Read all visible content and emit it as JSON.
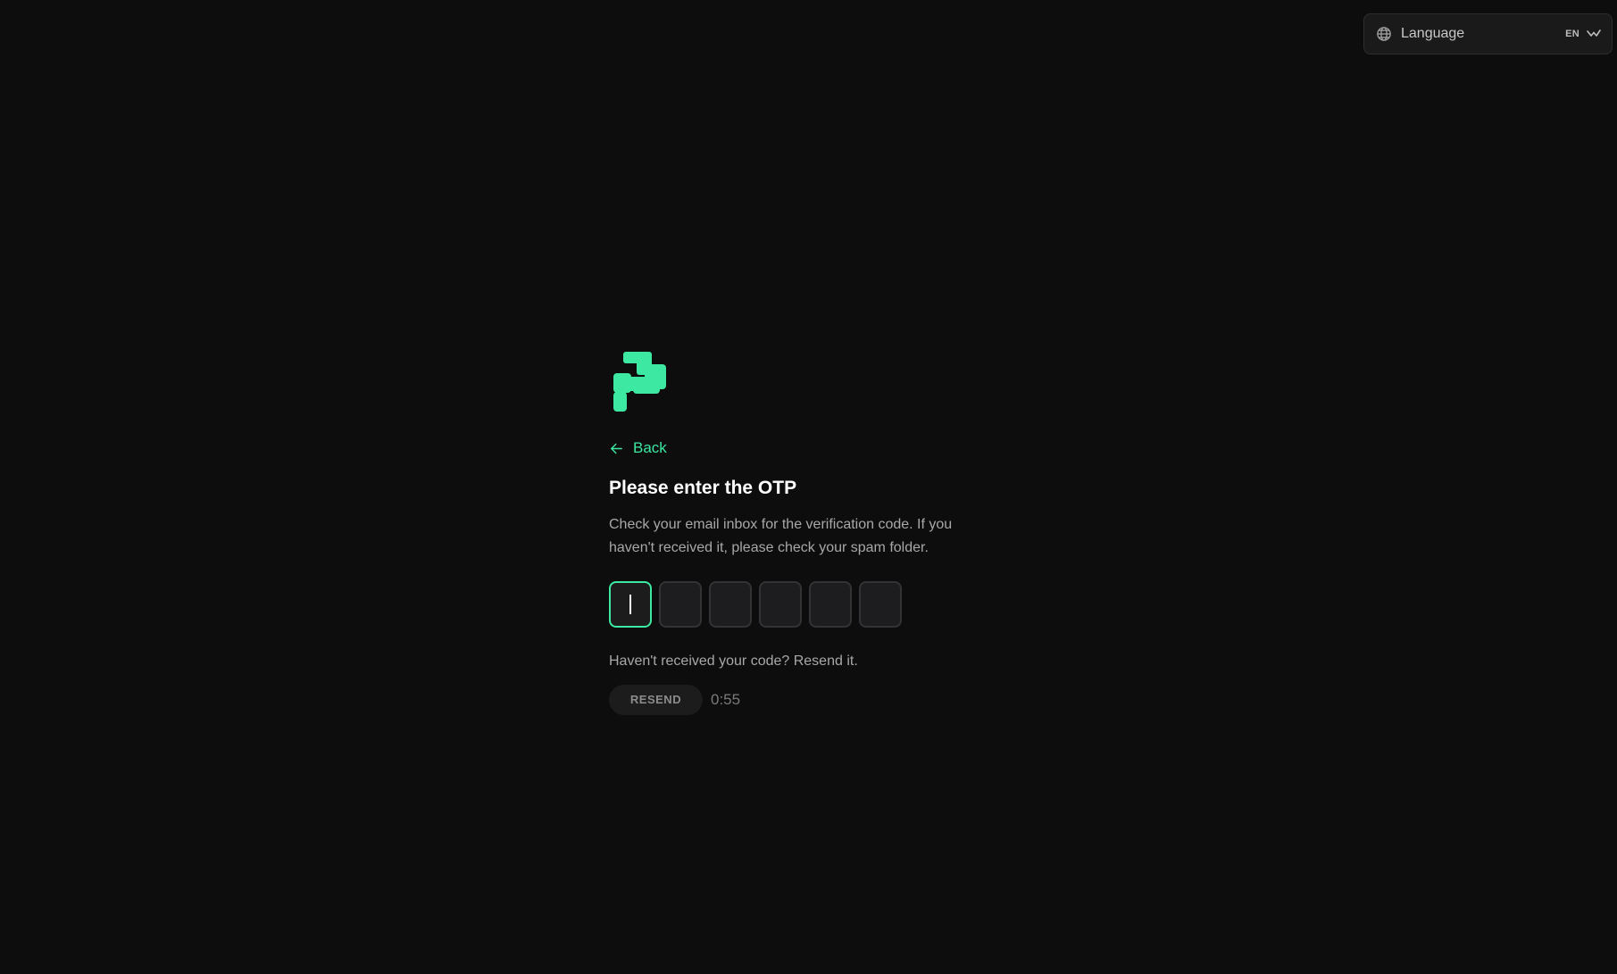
{
  "language_selector": {
    "label": "Language",
    "code": "EN",
    "icon": "globe-icon",
    "chevron_icon": "chevron-down-icon"
  },
  "brand": {
    "logo_icon": "brand-logo",
    "accent_color": "#3ce8a2"
  },
  "back": {
    "label": "Back",
    "icon": "arrow-left-icon"
  },
  "otp": {
    "title": "Please enter the OTP",
    "description": "Check your email inbox for the verification code. If you haven't received it, please check your spam folder.",
    "digits": [
      "",
      "",
      "",
      "",
      "",
      ""
    ],
    "focused_index": 0
  },
  "resend": {
    "hint": "Haven't received your code? Resend it.",
    "button_label": "RESEND",
    "timer": "0:55",
    "enabled": false
  }
}
